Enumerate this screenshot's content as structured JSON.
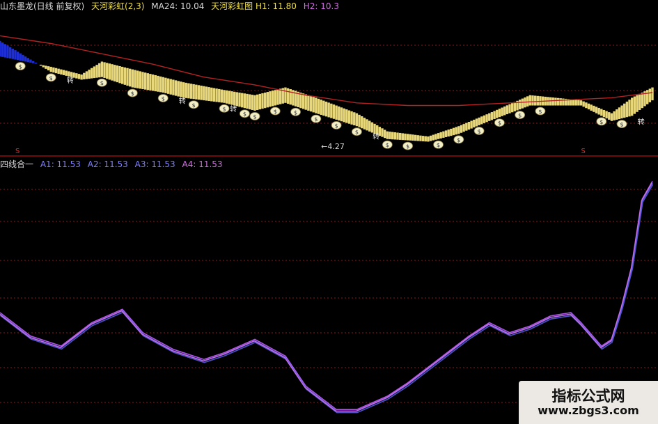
{
  "top_header": {
    "stock": "山东墨龙(日线 前复权)",
    "indicator": "天河彩虹(2,3)",
    "ma24": "MA24: 10.04",
    "rainbow": "天河彩虹图",
    "h1": "H1: 11.80",
    "h2": "H2: 10.3"
  },
  "bottom_header": {
    "name": "四线合一",
    "a1": "A1: 11.53",
    "a2": "A2: 11.53",
    "a3": "A3: 11.53",
    "a4": "A4: 11.53"
  },
  "annotations": {
    "low_marker": "4.27",
    "turn_label": "转",
    "coin_label": "$",
    "signal_label": "S"
  },
  "colors": {
    "background": "#000000",
    "grid": "#8a1a1a",
    "ma_line": "#b22222",
    "band_blue": "#1e2fd6",
    "band_yellow": "#e8d87a",
    "coin": "#f2efc8",
    "line_a": "#c060ff",
    "line_b": "#6a6aff",
    "header_white": "#d8d8d8",
    "header_yellow": "#f0e04a",
    "header_purple": "#d070e0",
    "header_blue": "#7f7fff"
  },
  "chart_data": [
    {
      "type": "line",
      "title": "天河彩虹(2,3)",
      "series": [
        {
          "name": "MA24",
          "x": [
            0,
            5,
            10,
            15,
            20,
            25,
            30,
            35,
            40,
            45,
            50,
            55,
            60,
            64
          ],
          "values": [
            12.6,
            12.3,
            11.9,
            11.5,
            11.0,
            10.7,
            10.3,
            10.0,
            9.9,
            9.9,
            10.0,
            10.1,
            10.2,
            10.4
          ],
          "color": "#b22222"
        },
        {
          "name": "H1",
          "x": [
            0,
            5,
            8,
            10,
            13,
            16,
            18,
            22,
            25,
            28,
            31,
            35,
            38,
            42,
            45,
            48,
            52,
            57,
            60,
            62,
            64
          ],
          "values": [
            11.8,
            11.4,
            11.1,
            11.6,
            11.3,
            11.0,
            10.8,
            10.5,
            10.3,
            10.6,
            10.2,
            9.6,
            8.9,
            8.7,
            9.1,
            9.6,
            10.3,
            10.1,
            9.6,
            10.2,
            10.6
          ],
          "color": "#e8d87a"
        },
        {
          "name": "H2",
          "x": [
            0,
            5,
            8,
            10,
            13,
            16,
            18,
            22,
            25,
            28,
            31,
            35,
            38,
            42,
            45,
            48,
            52,
            57,
            60,
            62,
            64
          ],
          "values": [
            12.4,
            11.2,
            10.9,
            11.0,
            10.6,
            10.4,
            10.2,
            10.0,
            9.7,
            10.0,
            9.6,
            9.1,
            8.6,
            8.5,
            8.8,
            9.3,
            9.9,
            9.9,
            9.3,
            9.5,
            10.1
          ],
          "color": "#1e2fd6"
        }
      ]
    },
    {
      "type": "line",
      "title": "四线合一",
      "x": [
        0,
        3,
        6,
        9,
        12,
        14,
        17,
        20,
        22,
        25,
        28,
        30,
        33,
        35,
        38,
        40,
        43,
        46,
        48,
        50,
        52,
        54,
        56,
        57,
        59,
        60,
        61,
        62,
        63,
        64
      ],
      "series": [
        {
          "name": "A1",
          "values": [
            7.6,
            6.9,
            6.6,
            7.3,
            7.7,
            7.0,
            6.5,
            6.2,
            6.4,
            6.8,
            6.3,
            5.4,
            4.7,
            4.7,
            5.1,
            5.5,
            6.2,
            6.9,
            7.3,
            7.0,
            7.2,
            7.5,
            7.6,
            7.3,
            6.6,
            6.8,
            7.8,
            9.0,
            11.0,
            11.53
          ],
          "color": "#c060ff"
        },
        {
          "name": "A2",
          "values": [
            7.6,
            6.9,
            6.6,
            7.3,
            7.7,
            7.0,
            6.5,
            6.2,
            6.4,
            6.8,
            6.3,
            5.4,
            4.7,
            4.7,
            5.1,
            5.5,
            6.2,
            6.9,
            7.3,
            7.0,
            7.2,
            7.5,
            7.6,
            7.3,
            6.6,
            6.8,
            7.8,
            9.0,
            11.0,
            11.53
          ],
          "color": "#6a6aff"
        },
        {
          "name": "A3",
          "values": [
            7.6,
            6.9,
            6.6,
            7.3,
            7.7,
            7.0,
            6.5,
            6.2,
            6.4,
            6.8,
            6.3,
            5.4,
            4.7,
            4.7,
            5.1,
            5.5,
            6.2,
            6.9,
            7.3,
            7.0,
            7.2,
            7.5,
            7.6,
            7.3,
            6.6,
            6.8,
            7.8,
            9.0,
            11.0,
            11.53
          ],
          "color": "#5a5ae0"
        },
        {
          "name": "A4",
          "values": [
            7.6,
            6.9,
            6.6,
            7.3,
            7.7,
            7.0,
            6.5,
            6.2,
            6.4,
            6.8,
            6.3,
            5.4,
            4.7,
            4.7,
            5.1,
            5.5,
            6.2,
            6.9,
            7.3,
            7.0,
            7.2,
            7.5,
            7.6,
            7.3,
            6.6,
            6.8,
            7.8,
            9.0,
            11.0,
            11.53
          ],
          "color": "#d070e0"
        }
      ],
      "ylim": [
        4.5,
        12.0
      ]
    }
  ],
  "watermark": {
    "title": "指标公式网",
    "url": "www.zbgs3.com"
  }
}
